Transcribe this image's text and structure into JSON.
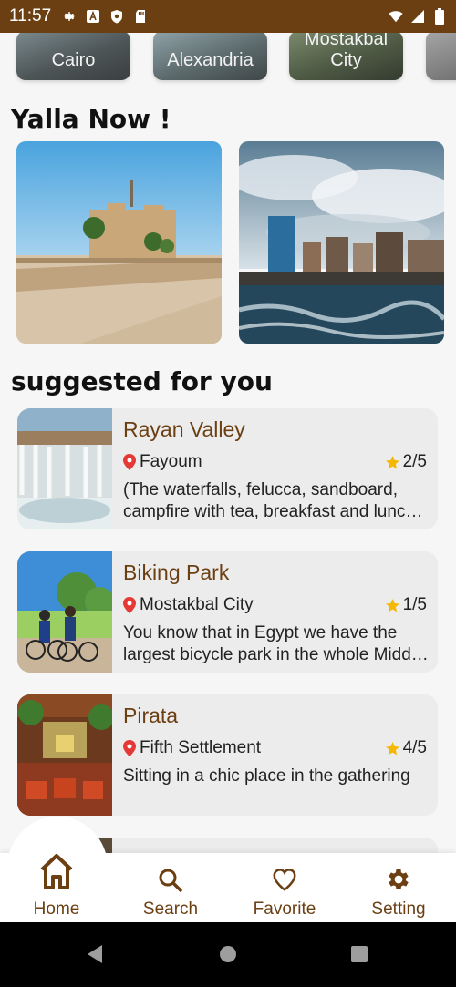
{
  "status_bar": {
    "time": "11:57"
  },
  "cities": [
    "Cairo",
    "Alexandria",
    "Mostakbal City"
  ],
  "sections": {
    "now_title": "Yalla Now !",
    "suggested_title": "suggested for you"
  },
  "suggestions": [
    {
      "title": "Rayan Valley",
      "location": "Fayoum",
      "rating": "2/5",
      "description": "(The waterfalls, felucca, sandboard, campfire with tea, breakfast and lunch, an..."
    },
    {
      "title": "Biking Park",
      "location": "Mostakbal City",
      "rating": "1/5",
      "description": "You know that in Egypt we have the largest bicycle park in the whole Middle East 😍"
    },
    {
      "title": "Pirata",
      "location": "Fifth Settlement",
      "rating": "4/5",
      "description": "Sitting in a chic place in the gathering"
    }
  ],
  "nav": {
    "home": "Home",
    "search": "Search",
    "favorite": "Favorite",
    "setting": "Setting"
  },
  "colors": {
    "brand": "#6b3f12",
    "star": "#f5b800",
    "pin": "#e53935"
  }
}
